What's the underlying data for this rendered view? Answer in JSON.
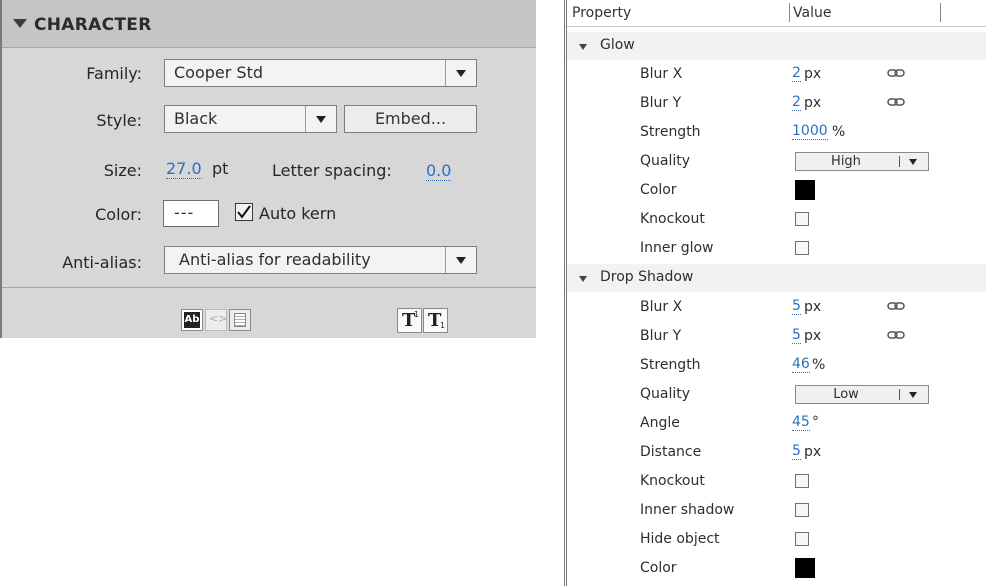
{
  "character": {
    "title": "CHARACTER",
    "family": {
      "label": "Family:",
      "value": "Cooper Std"
    },
    "style": {
      "label": "Style:",
      "value": "Black",
      "embed_label": "Embed..."
    },
    "size": {
      "label": "Size:",
      "value": "27.0",
      "unit": "pt"
    },
    "letter_spacing": {
      "label": "Letter spacing:",
      "value": "0.0"
    },
    "color": {
      "label": "Color:",
      "value": "---"
    },
    "auto_kern": {
      "label": "Auto kern",
      "checked": true
    },
    "anti_alias": {
      "label": "Anti-alias:",
      "value": "Anti-alias for readability"
    },
    "footer_icons": [
      "selectable-text-icon",
      "render-html-icon",
      "show-border-icon",
      "superscript-icon",
      "subscript-icon"
    ]
  },
  "props": {
    "header": {
      "property": "Property",
      "value": "Value"
    },
    "glow": {
      "name": "Glow",
      "blur_x": {
        "name": "Blur X",
        "value": "2",
        "unit": "px"
      },
      "blur_y": {
        "name": "Blur Y",
        "value": "2",
        "unit": "px"
      },
      "strength": {
        "name": "Strength",
        "value": "1000",
        "unit": "%"
      },
      "quality": {
        "name": "Quality",
        "value": "High"
      },
      "color": {
        "name": "Color",
        "swatch": "#000000"
      },
      "knockout": {
        "name": "Knockout",
        "checked": false
      },
      "inner_glow": {
        "name": "Inner glow",
        "checked": false
      }
    },
    "drop_shadow": {
      "name": "Drop Shadow",
      "blur_x": {
        "name": "Blur X",
        "value": "5",
        "unit": "px"
      },
      "blur_y": {
        "name": "Blur Y",
        "value": "5",
        "unit": "px"
      },
      "strength": {
        "name": "Strength",
        "value": "46",
        "unit": "%"
      },
      "quality": {
        "name": "Quality",
        "value": "Low"
      },
      "angle": {
        "name": "Angle",
        "value": "45",
        "unit": "°"
      },
      "distance": {
        "name": "Distance",
        "value": "5",
        "unit": "px"
      },
      "knockout": {
        "name": "Knockout",
        "checked": false
      },
      "inner_shadow": {
        "name": "Inner shadow",
        "checked": false
      },
      "hide_object": {
        "name": "Hide object",
        "checked": false
      },
      "color": {
        "name": "Color",
        "swatch": "#000000"
      }
    }
  },
  "colors": {
    "link": "#2d6fc1",
    "panel_bg": "#d7d7d7",
    "header_bg": "#c5c5c5"
  }
}
